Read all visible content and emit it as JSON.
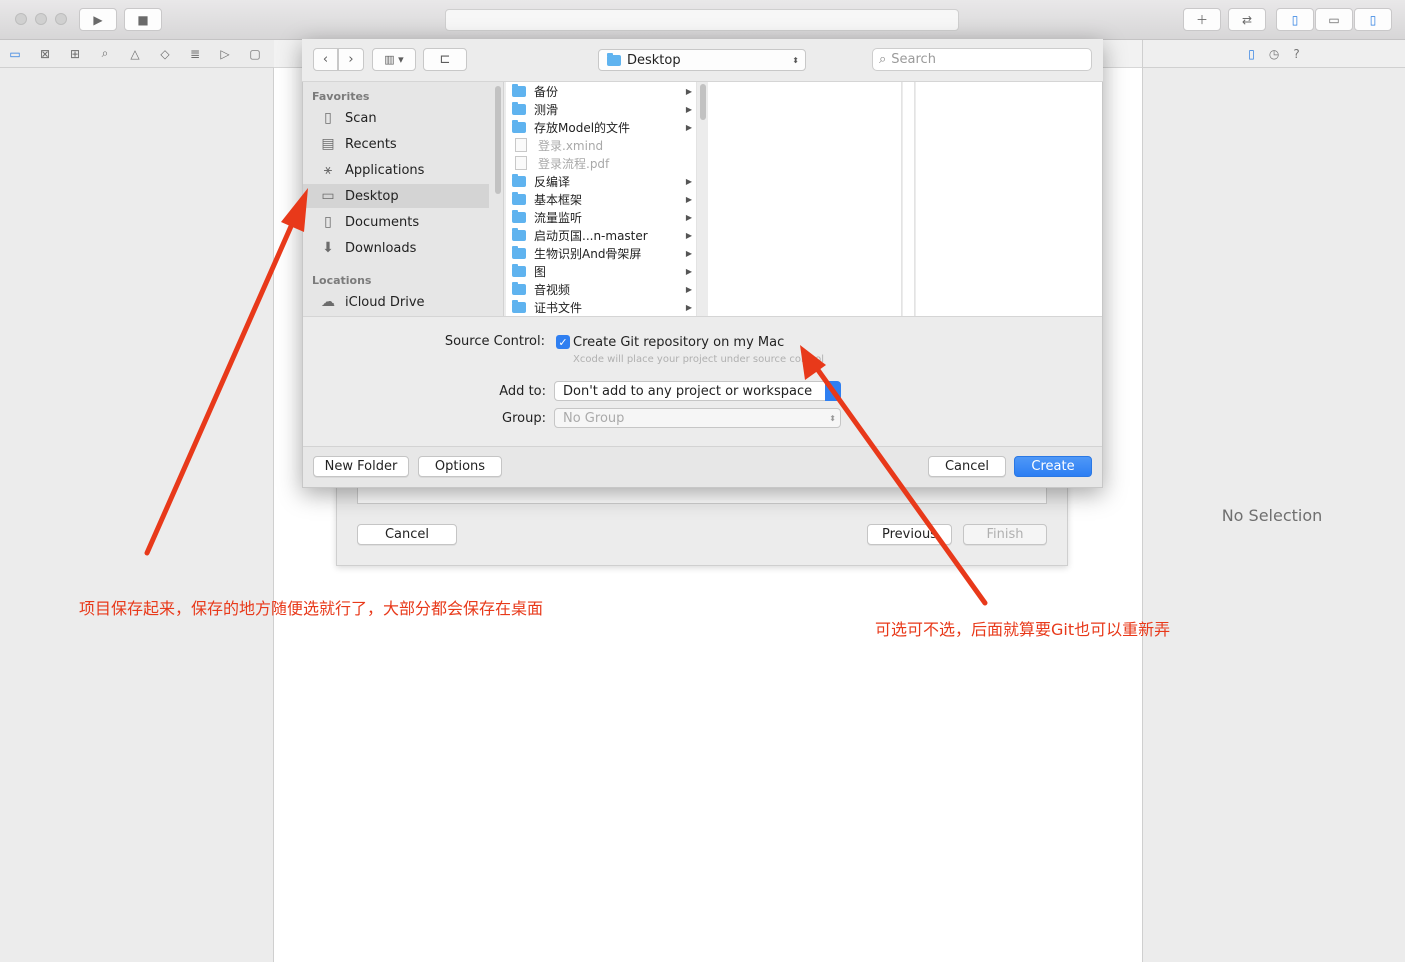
{
  "wizard": {
    "cancel_label": "Cancel",
    "previous_label": "Previous",
    "finish_label": "Finish"
  },
  "inspector": {
    "empty_text": "No Selection"
  },
  "save_sheet": {
    "location": "Desktop",
    "search_placeholder": "Search",
    "sidebar": {
      "favorites_header": "Favorites",
      "locations_header": "Locations",
      "items": [
        {
          "label": "Scan",
          "icon": "document-icon"
        },
        {
          "label": "Recents",
          "icon": "recents-icon"
        },
        {
          "label": "Applications",
          "icon": "applications-icon"
        },
        {
          "label": "Desktop",
          "icon": "desktop-icon",
          "selected": true
        },
        {
          "label": "Documents",
          "icon": "documents-icon"
        },
        {
          "label": "Downloads",
          "icon": "downloads-icon"
        }
      ],
      "locations": [
        {
          "label": "iCloud Drive",
          "icon": "cloud-icon"
        }
      ]
    },
    "files": [
      {
        "name": "备份",
        "kind": "folder"
      },
      {
        "name": "测滑",
        "kind": "folder"
      },
      {
        "name": "存放Model的文件",
        "kind": "folder"
      },
      {
        "name": "登录.xmind",
        "kind": "file"
      },
      {
        "name": "登录流程.pdf",
        "kind": "file"
      },
      {
        "name": "反编译",
        "kind": "folder"
      },
      {
        "name": "基本框架",
        "kind": "folder"
      },
      {
        "name": "流量监听",
        "kind": "folder"
      },
      {
        "name": "启动页国...n-master",
        "kind": "folder"
      },
      {
        "name": "生物识别And骨架屏",
        "kind": "folder"
      },
      {
        "name": "图",
        "kind": "folder"
      },
      {
        "name": "音视频",
        "kind": "folder"
      },
      {
        "name": "证书文件",
        "kind": "folder"
      }
    ],
    "source_control": {
      "label": "Source Control:",
      "checkbox_label": "Create Git repository on my Mac",
      "checked": true,
      "hint": "Xcode will place your project under source control"
    },
    "add_to": {
      "label": "Add to:",
      "value": "Don't add to any project or workspace"
    },
    "group": {
      "label": "Group:",
      "value": "No Group"
    },
    "new_folder_label": "New Folder",
    "options_label": "Options",
    "cancel_label": "Cancel",
    "create_label": "Create"
  },
  "annotations": {
    "left": "项目保存起来，保存的地方随便选就行了，大部分都会保存在桌面",
    "right": "可选可不选，后面就算要Git也可以重新弄",
    "color": "#e8391a"
  }
}
